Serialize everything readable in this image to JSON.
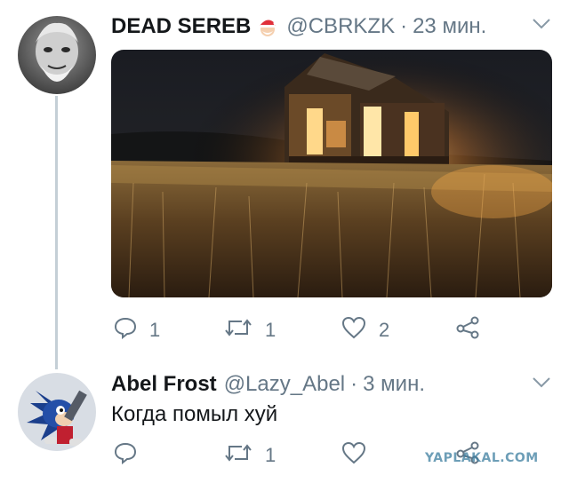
{
  "tweet1": {
    "name": "DEAD SEREB",
    "name_emoji": "santa-hat-icon",
    "handle": "@CBRKZK",
    "separator": "·",
    "time": "23 мин.",
    "actions": {
      "reply_count": "1",
      "retweet_count": "1",
      "like_count": "2"
    }
  },
  "tweet2": {
    "name": "Abel Frost",
    "handle": "@Lazy_Abel",
    "separator": "·",
    "time": "3 мин.",
    "text": "Когда помыл хуй"
  },
  "watermark": "YAPLAKAL.COM",
  "colors": {
    "secondary_text": "#657786",
    "thread_line": "#c4cfd6",
    "watermark": "#3d7ea0"
  }
}
